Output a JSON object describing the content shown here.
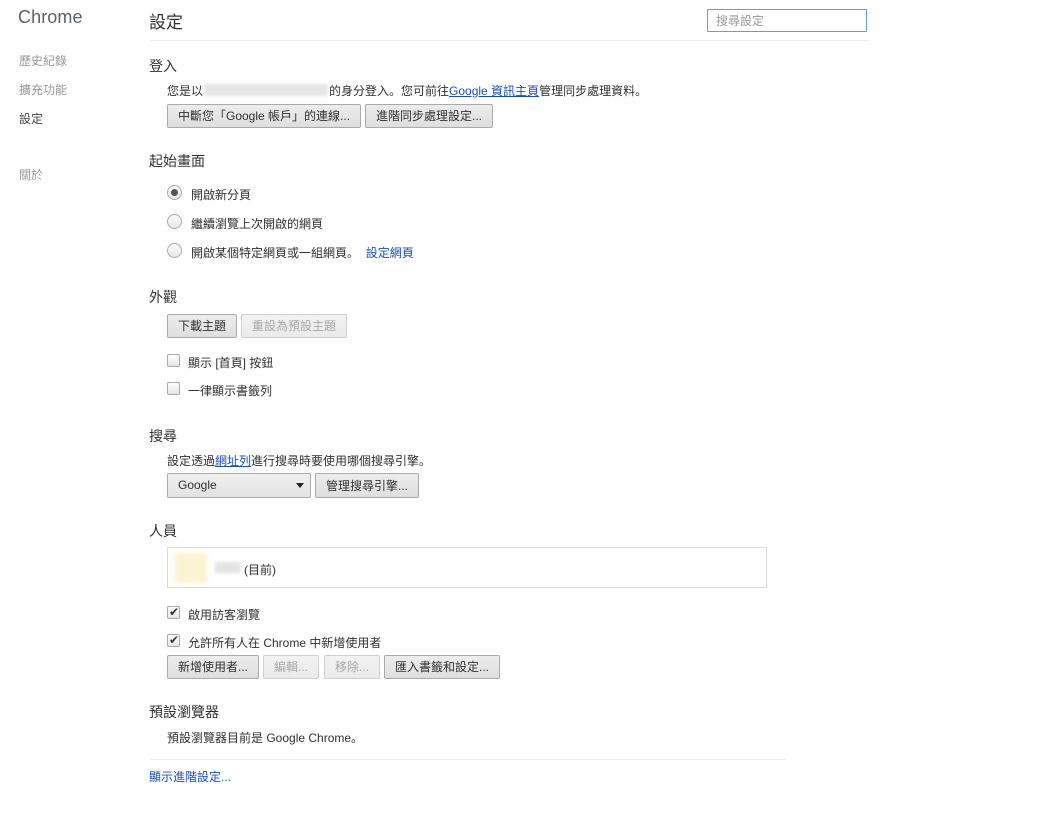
{
  "app": {
    "brand": "Chrome"
  },
  "sidebar": {
    "items": [
      {
        "label": "歷史紀錄"
      },
      {
        "label": "擴充功能"
      },
      {
        "label": "設定"
      },
      {
        "label": "關於"
      }
    ]
  },
  "header": {
    "title": "設定",
    "search_placeholder": "搜尋設定",
    "search_value": ""
  },
  "signin": {
    "title": "登入",
    "text_before": "您是以",
    "text_middle": "的身分登入。您可前往",
    "link": "Google 資訊主頁",
    "text_after": "管理同步處理資料。",
    "disconnect_button": "中斷您「Google 帳戶」的連線...",
    "advanced_sync_button": "進階同步處理設定..."
  },
  "startup": {
    "title": "起始畫面",
    "options": [
      {
        "label": "開啟新分頁",
        "selected": true
      },
      {
        "label": "繼續瀏覽上次開啟的網頁",
        "selected": false
      },
      {
        "label": "開啟某個特定網頁或一組網頁。",
        "selected": false
      }
    ],
    "set_pages_link": "設定網頁"
  },
  "appearance": {
    "title": "外觀",
    "get_themes_button": "下載主題",
    "reset_theme_button": "重設為預設主題",
    "show_home_button": {
      "label": "顯示 [首頁] 按鈕",
      "checked": false
    },
    "show_bookmarks_bar": {
      "label": "一律顯示書籤列",
      "checked": false
    }
  },
  "search": {
    "title": "搜尋",
    "desc_before": "設定透過",
    "omnibox_link": "網址列",
    "desc_after": "進行搜尋時要使用哪個搜尋引擎。",
    "engine_selected": "Google",
    "manage_button": "管理搜尋引擎..."
  },
  "people": {
    "title": "人員",
    "current_label": "(目前)",
    "guest_browsing": {
      "label": "啟用訪客瀏覽",
      "checked": true
    },
    "anyone_add": {
      "label": "允許所有人在 Chrome 中新增使用者",
      "checked": true
    },
    "add_button": "新增使用者...",
    "edit_button": "編輯...",
    "remove_button": "移除...",
    "import_button": "匯入書籤和設定..."
  },
  "default_browser": {
    "title": "預設瀏覽器",
    "text": "預設瀏覽器目前是 Google Chrome。"
  },
  "advanced_link": "顯示進階設定...",
  "colors": {
    "link": "#1a4fbb",
    "search_border": "#6b9bd8"
  }
}
